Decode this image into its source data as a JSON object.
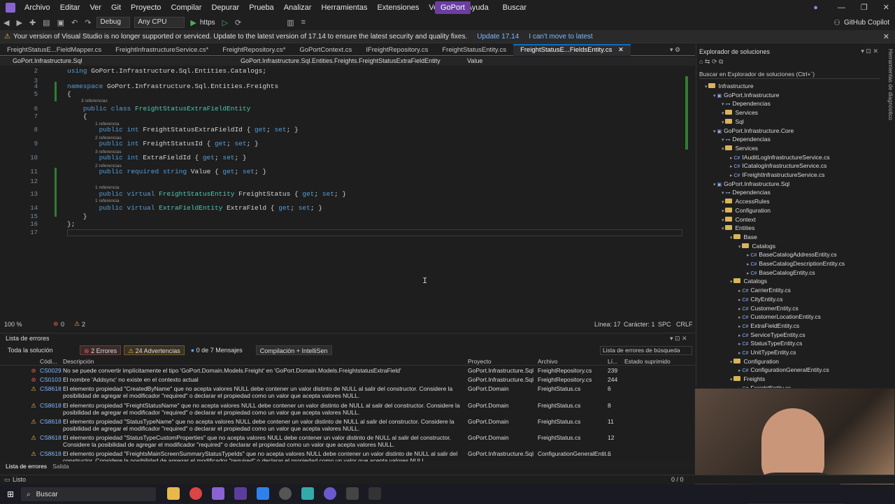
{
  "menubar": {
    "items": [
      "Archivo",
      "Editar",
      "Ver",
      "Git",
      "Proyecto",
      "Compilar",
      "Depurar",
      "Prueba",
      "Analizar",
      "Herramientas",
      "Extensiones",
      "Ventana",
      "Ayuda"
    ],
    "search_label": "Buscar",
    "solution_name": "GoPort"
  },
  "toolbar": {
    "config": "Debug",
    "platform": "Any CPU",
    "run_label": "https",
    "copilot": "GitHub Copilot"
  },
  "infobar": {
    "message": "Your version of Visual Studio is no longer supported or serviced. Update to the latest version of 17.14 to ensure the latest security and quality fixes.",
    "update_link": "Update 17.14",
    "cant_move_link": "I can't move to latest"
  },
  "tabs": [
    "FreightStatusE...FieldMapper.cs",
    "FreightInfrastructureService.cs*",
    "FreightRepository.cs*",
    "GoPortContext.cs",
    "IFreightRepository.cs",
    "FreightStatusEntity.cs",
    "FreightStatusE...FieldsEntity.cs"
  ],
  "navbar": {
    "project": "GoPort.Infrastructure.Sql",
    "class": "GoPort.Infrastructure.Sql.Entities.Freights.FreightStatusExtraFieldEntity",
    "member": "Value"
  },
  "code": {
    "lines": [
      {
        "n": "2",
        "text": "using GoPort.Infrastructure.Sql.Entities.Catalogs;"
      },
      {
        "n": "3",
        "text": ""
      },
      {
        "n": "4",
        "text": "namespace GoPort.Infrastructure.Sql.Entities.Freights"
      },
      {
        "n": "5",
        "text": "{"
      },
      {
        "n": "6",
        "text": "    public class FreightStatusExtraFieldEntity"
      },
      {
        "n": "7",
        "text": "    {"
      },
      {
        "n": "8",
        "text": "        public int FreightStatusExtraFieldId { get; set; }"
      },
      {
        "n": "9",
        "text": "        public int FreightStatusId { get; set; }"
      },
      {
        "n": "10",
        "text": "        public int ExtraFieldId { get; set; }"
      },
      {
        "n": "11",
        "text": "        public required string Value { get; set; }"
      },
      {
        "n": "12",
        "text": ""
      },
      {
        "n": "13",
        "text": "        public virtual FreightStatusEntity FreightStatus { get; set; }"
      },
      {
        "n": "14",
        "text": "        public virtual ExtraFieldEntity ExtraField { get; set; }"
      },
      {
        "n": "15",
        "text": "    }"
      },
      {
        "n": "16",
        "text": "};"
      },
      {
        "n": "17",
        "text": ""
      }
    ],
    "hints": [
      "3 referencias",
      "1 referencia",
      "2 referencias",
      "3 referencias",
      "2 referencias",
      "1 referencia",
      "1 referencia"
    ]
  },
  "edstatus": {
    "zoom": "100 %",
    "errors": "0",
    "warnings": "2",
    "line": "Línea: 17",
    "col": "Carácter: 1",
    "spc": "SPC",
    "crlf": "CRLF"
  },
  "errors": {
    "title": "Lista de errores",
    "scope": "Toda la solución",
    "err_btn": "2 Errores",
    "warn_btn": "24 Advertencias",
    "msg_btn": "0 de 7 Mensajes",
    "build_btn": "Compilación + IntelliSen",
    "search_placeholder": "Lista de errores de búsqueda",
    "headers": [
      "Códi...",
      "Descripción",
      "Proyecto",
      "Archivo",
      "Lí...",
      "Estado suprimido"
    ],
    "rows": [
      {
        "kind": "error",
        "code": "CS0029",
        "desc": "No se puede convertir implícitamente el tipo 'GoPort.Domain.Models.Freight' en 'GoPort.Domain.Models.FreightstatusExtraField'",
        "proj": "GoPort.Infrastructure.Sql",
        "file": "FreightRepository.cs",
        "line": "239"
      },
      {
        "kind": "error",
        "code": "CS0103",
        "desc": "El nombre 'Addsync' no existe en el contexto actual",
        "proj": "GoPort.Infrastructure.Sql",
        "file": "FreightRepository.cs",
        "line": "244"
      },
      {
        "kind": "warning",
        "code": "CS8618",
        "desc": "El elemento propiedad \"CreatedByName\" que no acepta valores NULL debe contener un valor distinto de NULL al salir del constructor. Considere la posibilidad de agregar el modificador \"required\" o declarar el propiedad como un valor que acepta valores NULL.",
        "proj": "GoPort.Domain",
        "file": "FreightStatus.cs",
        "line": "6"
      },
      {
        "kind": "warning",
        "code": "CS8618",
        "desc": "El elemento propiedad \"FreightStatusName\" que no acepta valores NULL debe contener un valor distinto de NULL al salir del constructor. Considere la posibilidad de agregar el modificador \"required\" o declarar el propiedad como un valor que acepta valores NULL.",
        "proj": "GoPort.Domain",
        "file": "FreightStatus.cs",
        "line": "8"
      },
      {
        "kind": "warning",
        "code": "CS8618",
        "desc": "El elemento propiedad \"StatusTypeName\" que no acepta valores NULL debe contener un valor distinto de NULL al salir del constructor. Considere la posibilidad de agregar el modificador \"required\" o declarar el propiedad como un valor que acepta valores NULL.",
        "proj": "GoPort.Domain",
        "file": "FreightStatus.cs",
        "line": "11"
      },
      {
        "kind": "warning",
        "code": "CS8618",
        "desc": "El elemento propiedad \"StatusTypeCustomProperties\" que no acepta valores NULL debe contener un valor distinto de NULL al salir del constructor. Considere la posibilidad de agregar el modificador \"required\" o declarar el propiedad como un valor que acepta valores NULL.",
        "proj": "GoPort.Domain",
        "file": "FreightStatus.cs",
        "line": "12"
      },
      {
        "kind": "warning",
        "code": "CS8618",
        "desc": "El elemento propiedad \"FreightsMainScreenSummaryStatusTypeIds\" que no acepta valores NULL debe contener un valor distinto de NULL al salir del constructor. Considere la posibilidad de agregar el modificador \"required\" o declarar el propiedad como un valor que acepta valores NULL.",
        "proj": "GoPort.Infrastructure.Sql",
        "file": "ConfigurationGeneralEntit...",
        "line": "6"
      }
    ]
  },
  "bottomtabs": [
    "Lista de errores",
    "Salida"
  ],
  "solution": {
    "title": "Explorador de soluciones",
    "search_placeholder": "Buscar en Explorador de soluciones (Ctrl+`)",
    "nodes": [
      {
        "label": "Infrastructure",
        "depth": 0,
        "type": "folder"
      },
      {
        "label": "GoPort.Infrastructure",
        "depth": 1,
        "type": "project"
      },
      {
        "label": "Dependencias",
        "depth": 2,
        "type": "deps"
      },
      {
        "label": "Services",
        "depth": 2,
        "type": "folder"
      },
      {
        "label": "Sql",
        "depth": 2,
        "type": "folder"
      },
      {
        "label": "GoPort.Infrastructure.Core",
        "depth": 1,
        "type": "project"
      },
      {
        "label": "Dependencias",
        "depth": 2,
        "type": "deps"
      },
      {
        "label": "Services",
        "depth": 2,
        "type": "folder"
      },
      {
        "label": "IAuditLogInfrastructureService.cs",
        "depth": 3,
        "type": "cs"
      },
      {
        "label": "ICatalogInfrastructureService.cs",
        "depth": 3,
        "type": "cs"
      },
      {
        "label": "IFreightInfrastructureService.cs",
        "depth": 3,
        "type": "cs"
      },
      {
        "label": "GoPort.Infrastructure.Sql",
        "depth": 1,
        "type": "project"
      },
      {
        "label": "Dependencias",
        "depth": 2,
        "type": "deps"
      },
      {
        "label": "AccessRules",
        "depth": 2,
        "type": "folder"
      },
      {
        "label": "Configuration",
        "depth": 2,
        "type": "folder"
      },
      {
        "label": "Context",
        "depth": 2,
        "type": "folder"
      },
      {
        "label": "Entities",
        "depth": 2,
        "type": "folder"
      },
      {
        "label": "Base",
        "depth": 3,
        "type": "folder"
      },
      {
        "label": "Catalogs",
        "depth": 4,
        "type": "folder"
      },
      {
        "label": "BaseCatalogAddressEntity.cs",
        "depth": 5,
        "type": "cs"
      },
      {
        "label": "BaseCatalogDescriptionEntity.cs",
        "depth": 5,
        "type": "cs"
      },
      {
        "label": "BaseCatalogEntity.cs",
        "depth": 5,
        "type": "cs"
      },
      {
        "label": "Catalogs",
        "depth": 3,
        "type": "folder"
      },
      {
        "label": "CarrierEntity.cs",
        "depth": 4,
        "type": "cs"
      },
      {
        "label": "CityEntity.cs",
        "depth": 4,
        "type": "cs"
      },
      {
        "label": "CustomerEntity.cs",
        "depth": 4,
        "type": "cs"
      },
      {
        "label": "CustomerLocationEntity.cs",
        "depth": 4,
        "type": "cs"
      },
      {
        "label": "ExtraFieldEntity.cs",
        "depth": 4,
        "type": "cs"
      },
      {
        "label": "ServiceTypeEntity.cs",
        "depth": 4,
        "type": "cs"
      },
      {
        "label": "StatusTypeEntity.cs",
        "depth": 4,
        "type": "cs"
      },
      {
        "label": "UnitTypeEntity.cs",
        "depth": 4,
        "type": "cs"
      },
      {
        "label": "Configuration",
        "depth": 3,
        "type": "folder"
      },
      {
        "label": "ConfigurationGeneralEntity.cs",
        "depth": 4,
        "type": "cs"
      },
      {
        "label": "Freights",
        "depth": 3,
        "type": "folder"
      },
      {
        "label": "FreightEntity.cs",
        "depth": 4,
        "type": "cs"
      }
    ]
  },
  "sidebar_vertical": "Herramientas de diagnóstico",
  "statusbar": {
    "left": "Listo",
    "right": "0 / 0"
  },
  "taskbar": {
    "search": "Buscar"
  }
}
